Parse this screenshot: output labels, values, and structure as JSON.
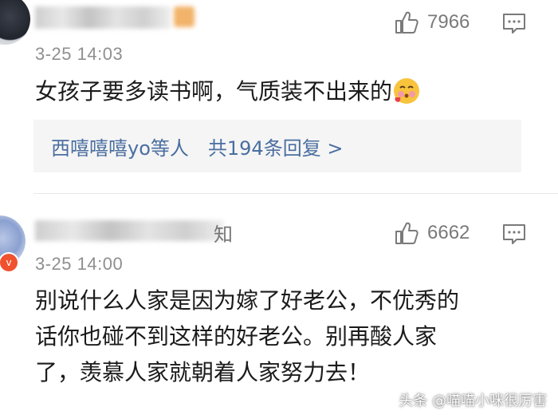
{
  "comments": [
    {
      "time": "3-25 14:03",
      "likes": "7966",
      "text": "女孩子要多读书啊，气质装不出来的",
      "emoji": "blushing-face-emoji",
      "replies": {
        "names": "西嘻嘻嘻yo等人",
        "summary": "共194条回复 >"
      }
    },
    {
      "name_tail": "知",
      "time": "3-25 14:00",
      "likes": "6662",
      "text_lines": [
        "别说什么人家是因为嫁了好老公，不优秀的",
        "话你也碰不到这样的好老公。别再酸人家",
        "了，羡慕人家就朝着人家努力去！"
      ],
      "badge": "v"
    }
  ],
  "watermark": "头条 @喵喵小咪很厉害",
  "colors": {
    "reply_link": "#4a6ea0",
    "meta_gray": "#8f8f8f",
    "badge_orange": "#f0522f"
  }
}
